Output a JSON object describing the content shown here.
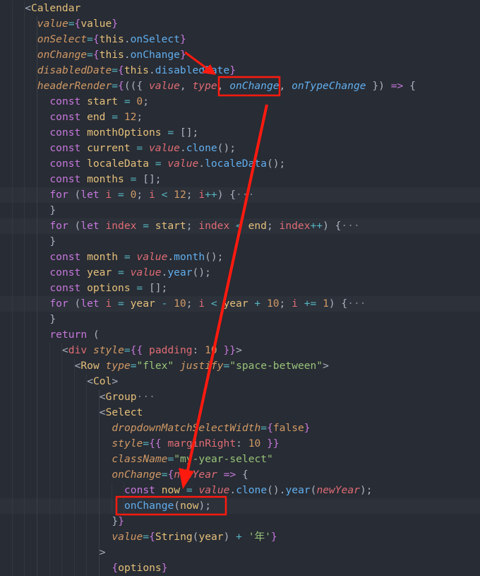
{
  "annotation_color": "#ff1a0f",
  "lines": [
    {
      "indent": 4,
      "tokens": [
        [
          "<",
          "p"
        ],
        [
          "Calendar",
          "v"
        ]
      ]
    },
    {
      "indent": 6,
      "tokens": [
        [
          "value",
          "a"
        ],
        [
          "=",
          "o"
        ],
        [
          "{",
          "b"
        ],
        [
          "value",
          "v"
        ],
        [
          "}",
          "b"
        ]
      ]
    },
    {
      "indent": 6,
      "tokens": [
        [
          "onSelect",
          "a"
        ],
        [
          "=",
          "o"
        ],
        [
          "{",
          "b"
        ],
        [
          "this",
          "v"
        ],
        [
          ".",
          "p"
        ],
        [
          "onSelect",
          "f"
        ],
        [
          "}",
          "b"
        ]
      ]
    },
    {
      "indent": 6,
      "tokens": [
        [
          "onChange",
          "a"
        ],
        [
          "=",
          "o"
        ],
        [
          "{",
          "b"
        ],
        [
          "this",
          "v"
        ],
        [
          ".",
          "p"
        ],
        [
          "onChange",
          "f"
        ],
        [
          "}",
          "b"
        ]
      ]
    },
    {
      "indent": 6,
      "tokens": [
        [
          "disabledDate",
          "a"
        ],
        [
          "=",
          "o"
        ],
        [
          "{",
          "b"
        ],
        [
          "this",
          "v"
        ],
        [
          ".",
          "p"
        ],
        [
          "disabledDate",
          "f"
        ],
        [
          "}",
          "b"
        ]
      ]
    },
    {
      "indent": 6,
      "tokens": [
        [
          "headerRender",
          "a"
        ],
        [
          "=",
          "o"
        ],
        [
          "{",
          "b"
        ],
        [
          "(({ ",
          "p"
        ],
        [
          "value",
          "ri"
        ],
        [
          ", ",
          "p"
        ],
        [
          "type",
          "ri"
        ],
        [
          ", ",
          "p"
        ],
        [
          "onChange",
          "fi"
        ],
        [
          ", ",
          "p"
        ],
        [
          "onTypeChange",
          "fi"
        ],
        [
          " }) ",
          "p"
        ],
        [
          "=>",
          "k"
        ],
        [
          " {",
          "p"
        ]
      ]
    },
    {
      "indent": 8,
      "tokens": [
        [
          "const",
          "k"
        ],
        [
          " start ",
          "v"
        ],
        [
          "=",
          "o"
        ],
        [
          " 0",
          "n"
        ],
        [
          ";",
          "p"
        ]
      ]
    },
    {
      "indent": 8,
      "tokens": [
        [
          "const",
          "k"
        ],
        [
          " end ",
          "v"
        ],
        [
          "=",
          "o"
        ],
        [
          " 12",
          "n"
        ],
        [
          ";",
          "p"
        ]
      ]
    },
    {
      "indent": 8,
      "tokens": [
        [
          "const",
          "k"
        ],
        [
          " monthOptions ",
          "v"
        ],
        [
          "=",
          "o"
        ],
        [
          " [];",
          "p"
        ]
      ]
    },
    {
      "indent": 8,
      "tokens": [
        [
          "const",
          "k"
        ],
        [
          " current ",
          "v"
        ],
        [
          "=",
          "o"
        ],
        [
          " ",
          "p"
        ],
        [
          "value",
          "ri"
        ],
        [
          ".",
          "p"
        ],
        [
          "clone",
          "f"
        ],
        [
          "();",
          "p"
        ]
      ]
    },
    {
      "indent": 8,
      "tokens": [
        [
          "const",
          "k"
        ],
        [
          " localeData ",
          "v"
        ],
        [
          "=",
          "o"
        ],
        [
          " ",
          "p"
        ],
        [
          "value",
          "ri"
        ],
        [
          ".",
          "p"
        ],
        [
          "localeData",
          "f"
        ],
        [
          "();",
          "p"
        ]
      ]
    },
    {
      "indent": 8,
      "tokens": [
        [
          "const",
          "k"
        ],
        [
          " months ",
          "v"
        ],
        [
          "=",
          "o"
        ],
        [
          " [];",
          "p"
        ]
      ]
    },
    {
      "indent": 8,
      "hl": true,
      "tokens": [
        [
          "for",
          "k"
        ],
        [
          " (",
          "p"
        ],
        [
          "let",
          "k"
        ],
        [
          " i ",
          "r"
        ],
        [
          "=",
          "o"
        ],
        [
          " 0",
          "n"
        ],
        [
          "; ",
          "p"
        ],
        [
          "i ",
          "r"
        ],
        [
          "<",
          "o"
        ],
        [
          " 12",
          "n"
        ],
        [
          "; ",
          "p"
        ],
        [
          "i",
          "r"
        ],
        [
          "++",
          "o"
        ],
        [
          ") {",
          "p"
        ],
        [
          "···",
          "fold"
        ]
      ]
    },
    {
      "indent": 8,
      "tokens": [
        [
          "}",
          "p"
        ]
      ]
    },
    {
      "indent": 8,
      "hl": true,
      "tokens": [
        [
          "for",
          "k"
        ],
        [
          " (",
          "p"
        ],
        [
          "let",
          "k"
        ],
        [
          " index ",
          "r"
        ],
        [
          "=",
          "o"
        ],
        [
          " start",
          "v"
        ],
        [
          "; ",
          "p"
        ],
        [
          "index ",
          "r"
        ],
        [
          "<",
          "o"
        ],
        [
          " end",
          "v"
        ],
        [
          "; ",
          "p"
        ],
        [
          "index",
          "r"
        ],
        [
          "++",
          "o"
        ],
        [
          ") {",
          "p"
        ],
        [
          "···",
          "fold"
        ]
      ]
    },
    {
      "indent": 8,
      "tokens": [
        [
          "}",
          "p"
        ]
      ]
    },
    {
      "indent": 8,
      "tokens": [
        [
          "const",
          "k"
        ],
        [
          " month ",
          "v"
        ],
        [
          "=",
          "o"
        ],
        [
          " ",
          "p"
        ],
        [
          "value",
          "ri"
        ],
        [
          ".",
          "p"
        ],
        [
          "month",
          "f"
        ],
        [
          "();",
          "p"
        ]
      ]
    },
    {
      "indent": 8,
      "tokens": [
        [
          "const",
          "k"
        ],
        [
          " year ",
          "v"
        ],
        [
          "=",
          "o"
        ],
        [
          " ",
          "p"
        ],
        [
          "value",
          "ri"
        ],
        [
          ".",
          "p"
        ],
        [
          "year",
          "f"
        ],
        [
          "();",
          "p"
        ]
      ]
    },
    {
      "indent": 8,
      "tokens": [
        [
          "const",
          "k"
        ],
        [
          " options ",
          "v"
        ],
        [
          "=",
          "o"
        ],
        [
          " [];",
          "p"
        ]
      ]
    },
    {
      "indent": 8,
      "hl": true,
      "tokens": [
        [
          "for",
          "k"
        ],
        [
          " (",
          "p"
        ],
        [
          "let",
          "k"
        ],
        [
          " i ",
          "r"
        ],
        [
          "=",
          "o"
        ],
        [
          " year ",
          "v"
        ],
        [
          "-",
          "o"
        ],
        [
          " 10",
          "n"
        ],
        [
          "; ",
          "p"
        ],
        [
          "i ",
          "r"
        ],
        [
          "<",
          "o"
        ],
        [
          " year ",
          "v"
        ],
        [
          "+",
          "o"
        ],
        [
          " 10",
          "n"
        ],
        [
          "; ",
          "p"
        ],
        [
          "i ",
          "r"
        ],
        [
          "+=",
          "o"
        ],
        [
          " 1",
          "n"
        ],
        [
          ") {",
          "p"
        ],
        [
          "···",
          "fold"
        ]
      ]
    },
    {
      "indent": 8,
      "tokens": [
        [
          "}",
          "p"
        ]
      ]
    },
    {
      "indent": 8,
      "tokens": [
        [
          "return",
          "k"
        ],
        [
          " (",
          "p"
        ]
      ]
    },
    {
      "indent": 10,
      "tokens": [
        [
          "<",
          "p"
        ],
        [
          "div",
          "r"
        ],
        [
          " style",
          "a"
        ],
        [
          "=",
          "o"
        ],
        [
          "{{ ",
          "b"
        ],
        [
          "padding",
          "r"
        ],
        [
          ": ",
          "p"
        ],
        [
          "10",
          "n"
        ],
        [
          " }}",
          "b"
        ],
        [
          ">",
          "p"
        ]
      ]
    },
    {
      "indent": 12,
      "tokens": [
        [
          "<",
          "p"
        ],
        [
          "Row",
          "v"
        ],
        [
          " type",
          "a"
        ],
        [
          "=",
          "o"
        ],
        [
          "\"flex\"",
          "s"
        ],
        [
          " justify",
          "a"
        ],
        [
          "=",
          "o"
        ],
        [
          "\"space-between\"",
          "s"
        ],
        [
          ">",
          "p"
        ]
      ]
    },
    {
      "indent": 14,
      "tokens": [
        [
          "<",
          "p"
        ],
        [
          "Col",
          "v"
        ],
        [
          ">",
          "p"
        ]
      ]
    },
    {
      "indent": 16,
      "tokens": [
        [
          "<",
          "p"
        ],
        [
          "Group",
          "v"
        ],
        [
          "···",
          "fold"
        ]
      ]
    },
    {
      "indent": 16,
      "tokens": [
        [
          "<",
          "p"
        ],
        [
          "Select",
          "v"
        ]
      ]
    },
    {
      "indent": 18,
      "tokens": [
        [
          "dropdownMatchSelectWidth",
          "a"
        ],
        [
          "=",
          "o"
        ],
        [
          "{",
          "b"
        ],
        [
          "false",
          "n"
        ],
        [
          "}",
          "b"
        ]
      ]
    },
    {
      "indent": 18,
      "tokens": [
        [
          "style",
          "a"
        ],
        [
          "=",
          "o"
        ],
        [
          "{{ ",
          "b"
        ],
        [
          "marginRight",
          "r"
        ],
        [
          ": ",
          "p"
        ],
        [
          "10",
          "n"
        ],
        [
          " }}",
          "b"
        ]
      ]
    },
    {
      "indent": 18,
      "tokens": [
        [
          "className",
          "a"
        ],
        [
          "=",
          "o"
        ],
        [
          "\"my-year-select\"",
          "s"
        ]
      ]
    },
    {
      "indent": 18,
      "tokens": [
        [
          "onChange",
          "a"
        ],
        [
          "=",
          "o"
        ],
        [
          "{",
          "b"
        ],
        [
          "newYear",
          "ri"
        ],
        [
          " =>",
          "k"
        ],
        [
          " {",
          "p"
        ]
      ]
    },
    {
      "indent": 20,
      "tokens": [
        [
          "const",
          "k"
        ],
        [
          " now ",
          "v"
        ],
        [
          "=",
          "o"
        ],
        [
          " ",
          "p"
        ],
        [
          "value",
          "ri"
        ],
        [
          ".",
          "p"
        ],
        [
          "clone",
          "f"
        ],
        [
          "().",
          "p"
        ],
        [
          "year",
          "f"
        ],
        [
          "(",
          "p"
        ],
        [
          "newYear",
          "ri"
        ],
        [
          ");",
          "p"
        ]
      ]
    },
    {
      "indent": 20,
      "hl": true,
      "tokens": [
        [
          "onChange",
          "f"
        ],
        [
          "(",
          "p"
        ],
        [
          "now",
          "v"
        ],
        [
          ");",
          "p"
        ]
      ]
    },
    {
      "indent": 18,
      "tokens": [
        [
          "}",
          "p"
        ],
        [
          "}",
          "b"
        ]
      ]
    },
    {
      "indent": 18,
      "tokens": [
        [
          "value",
          "a"
        ],
        [
          "=",
          "o"
        ],
        [
          "{",
          "b"
        ],
        [
          "String",
          "v"
        ],
        [
          "(",
          "p"
        ],
        [
          "year",
          "v"
        ],
        [
          ") ",
          "p"
        ],
        [
          "+",
          "o"
        ],
        [
          " '年'",
          "s"
        ],
        [
          "}",
          "b"
        ]
      ]
    },
    {
      "indent": 16,
      "tokens": [
        [
          ">",
          "p"
        ]
      ]
    },
    {
      "indent": 18,
      "tokens": [
        [
          "{",
          "b"
        ],
        [
          "options",
          "v"
        ],
        [
          "}",
          "b"
        ]
      ]
    }
  ]
}
